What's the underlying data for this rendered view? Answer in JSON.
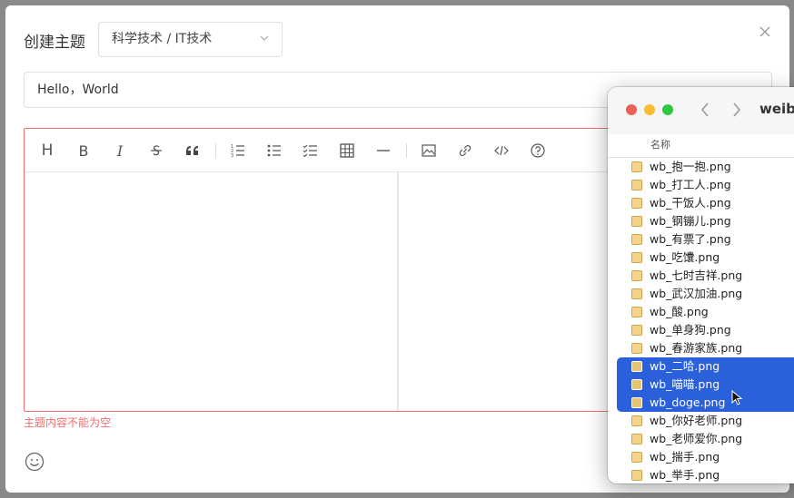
{
  "dialog": {
    "title": "创建主题",
    "category_select": "科学技术 / IT技术",
    "title_value": "Hello，World",
    "error_text": "主题内容不能为空"
  },
  "toolbar": {
    "items": [
      "heading-icon",
      "bold-icon",
      "italic-icon",
      "strikethrough-icon",
      "quote-icon",
      "ordered-list-icon",
      "unordered-list-icon",
      "task-list-icon",
      "table-icon",
      "horizontal-rule-icon",
      "image-icon",
      "link-icon",
      "code-icon",
      "help-icon"
    ],
    "heading": "H",
    "bold": "B",
    "italic": "I"
  },
  "finder": {
    "title": "weibo",
    "column_header": "名称",
    "files": [
      {
        "name": "wb_抱一抱.png",
        "selected": false
      },
      {
        "name": "wb_打工人.png",
        "selected": false
      },
      {
        "name": "wb_干饭人.png",
        "selected": false
      },
      {
        "name": "wb_钢镚儿.png",
        "selected": false
      },
      {
        "name": "wb_有票了.png",
        "selected": false
      },
      {
        "name": "wb_吃馕.png",
        "selected": false
      },
      {
        "name": "wb_七时吉祥.png",
        "selected": false
      },
      {
        "name": "wb_武汉加油.png",
        "selected": false
      },
      {
        "name": "wb_酸.png",
        "selected": false
      },
      {
        "name": "wb_单身狗.png",
        "selected": false
      },
      {
        "name": "wb_春游家族.png",
        "selected": false
      },
      {
        "name": "wb_二哈.png",
        "selected": true
      },
      {
        "name": "wb_喵喵.png",
        "selected": true
      },
      {
        "name": "wb_doge.png",
        "selected": true
      },
      {
        "name": "wb_你好老师.png",
        "selected": false
      },
      {
        "name": "wb_老师爱你.png",
        "selected": false
      },
      {
        "name": "wb_揣手.png",
        "selected": false
      },
      {
        "name": "wb_举手.png",
        "selected": false
      }
    ]
  },
  "colors": {
    "error": "#f56c6c",
    "selection": "#2a61db",
    "close_red": "#ee5f57",
    "minimize_yellow": "#f8be2e",
    "zoom_green": "#2ec840"
  }
}
